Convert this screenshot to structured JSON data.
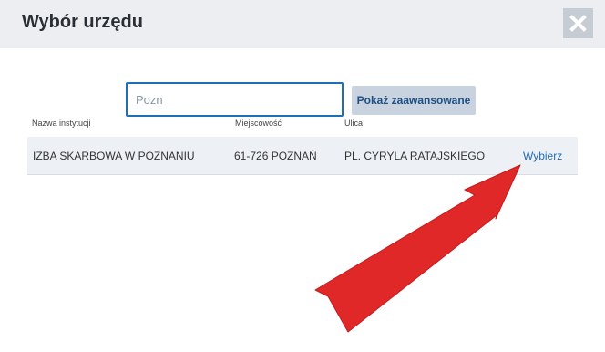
{
  "dialog": {
    "title": "Wybór urzędu"
  },
  "search": {
    "value": "",
    "placeholder": "Pozn",
    "advanced_label": "Pokaż zaawansowane"
  },
  "table": {
    "headers": {
      "institution": "Nazwa instytucji",
      "city": "Miejscowość",
      "street": "Ulica"
    },
    "rows": [
      {
        "institution": "IZBA SKARBOWA W POZNANIU",
        "city": "61-726 POZNAŃ",
        "street": "PL. CYRYLA RATAJSKIEGO",
        "action": "Wybierz"
      }
    ]
  },
  "colors": {
    "accent": "#1f6fb6",
    "annotation_arrow": "#e53030",
    "header_bg": "#eceef1",
    "row_bg": "#edf0f4"
  },
  "icons": {
    "close": "close-icon",
    "annotation": "red-arrow-pointer"
  }
}
